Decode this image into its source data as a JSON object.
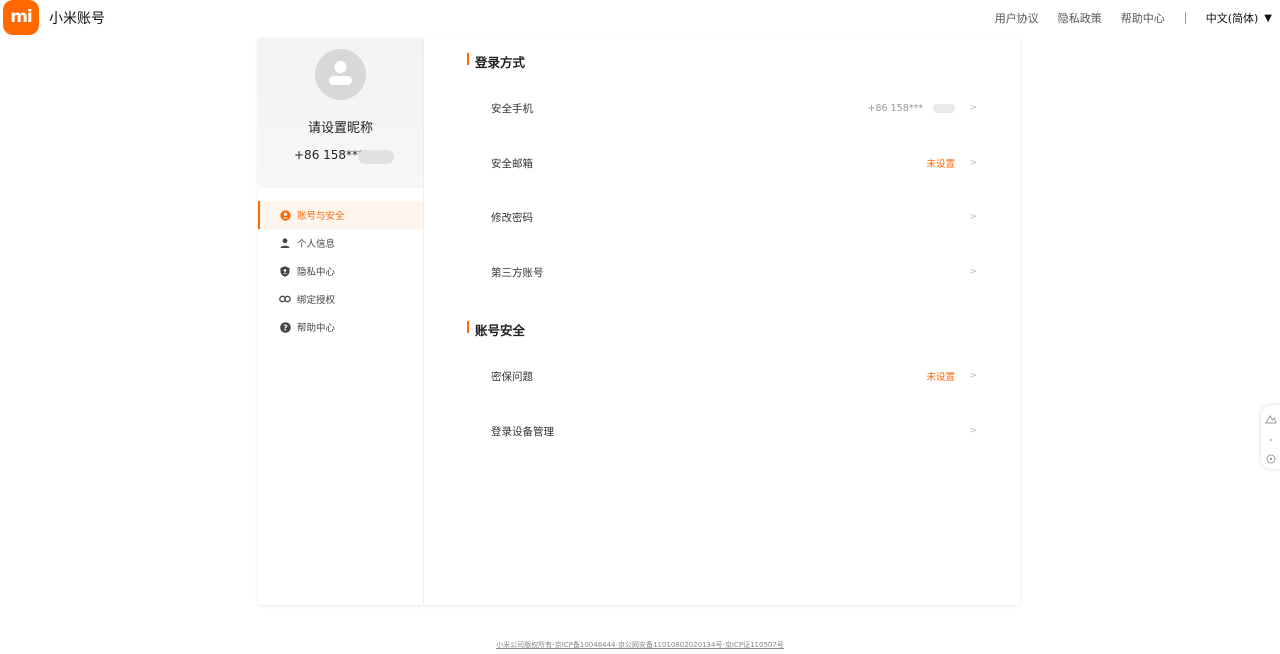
{
  "header": {
    "logo_text": "mi",
    "brand": "小米账号",
    "nav": [
      "用户协议",
      "隐私政策",
      "帮助中心"
    ],
    "language": "中文(简体)"
  },
  "profile": {
    "nickname": "请设置昵称",
    "phone": "+86 158***"
  },
  "menu": [
    {
      "label": "账号与安全",
      "icon": "account-circle-icon",
      "active": true
    },
    {
      "label": "个人信息",
      "icon": "person-icon",
      "active": false
    },
    {
      "label": "隐私中心",
      "icon": "shield-icon",
      "active": false
    },
    {
      "label": "绑定授权",
      "icon": "link-icon",
      "active": false
    },
    {
      "label": "帮助中心",
      "icon": "help-icon",
      "active": false
    }
  ],
  "sections": {
    "login_methods": {
      "title": "登录方式",
      "rows": [
        {
          "label": "安全手机",
          "value": "+86 158***",
          "status": "normal"
        },
        {
          "label": "安全邮箱",
          "value": "未设置",
          "status": "warn"
        },
        {
          "label": "修改密码",
          "value": "",
          "status": "normal"
        },
        {
          "label": "第三方账号",
          "value": "",
          "status": "normal"
        }
      ]
    },
    "account_security": {
      "title": "账号安全",
      "rows": [
        {
          "label": "密保问题",
          "value": "未设置",
          "status": "warn"
        },
        {
          "label": "登录设备管理",
          "value": "",
          "status": "normal"
        }
      ]
    }
  },
  "arrow": ">",
  "footer": "小米公司版权所有-京ICP备10046444-京公网安备11010802020134号-京ICP证110507号",
  "colors": {
    "accent": "#ff6900",
    "muted": "#999999"
  }
}
